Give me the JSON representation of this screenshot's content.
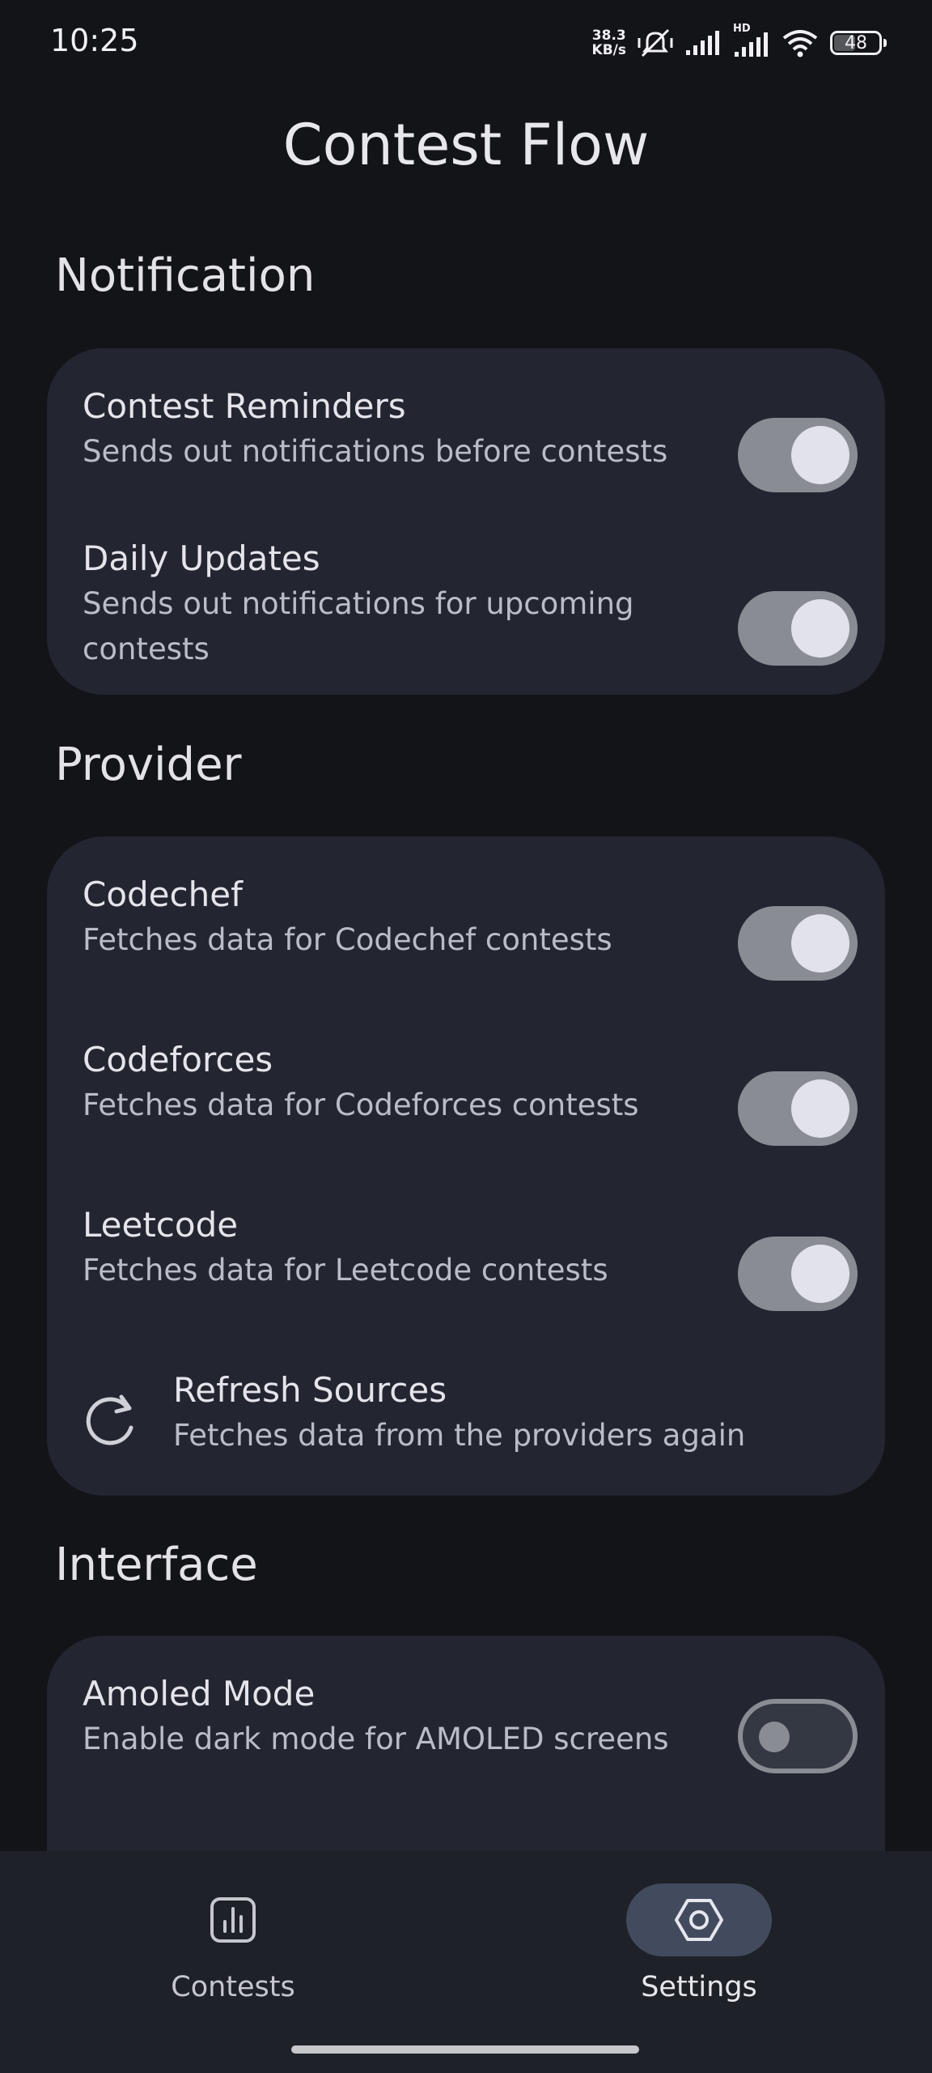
{
  "status_bar": {
    "time": "10:25",
    "net_speed_value": "38.3",
    "net_speed_unit": "KB/s",
    "hd_label": "HD",
    "battery": "48",
    "battery_level": 0.48
  },
  "app": {
    "title": "Contest Flow"
  },
  "sections": {
    "notification": {
      "title": "Notification",
      "items": [
        {
          "title": "Contest Reminders",
          "desc": "Sends out notifications before contests",
          "enabled": true
        },
        {
          "title": "Daily Updates",
          "desc": "Sends out notifications for upcoming contests",
          "enabled": true
        }
      ]
    },
    "provider": {
      "title": "Provider",
      "items": [
        {
          "title": "Codechef",
          "desc": "Fetches data for Codechef contests",
          "enabled": true
        },
        {
          "title": "Codeforces",
          "desc": "Fetches data for Codeforces contests",
          "enabled": true
        },
        {
          "title": "Leetcode",
          "desc": "Fetches data for Leetcode contests",
          "enabled": true
        }
      ],
      "refresh": {
        "title": "Refresh Sources",
        "desc": "Fetches data from the providers again",
        "icon": "refresh-icon"
      }
    },
    "interface": {
      "title": "Interface",
      "items": [
        {
          "title": "Amoled Mode",
          "desc": "Enable dark mode for AMOLED screens",
          "enabled": false
        }
      ]
    }
  },
  "bottom_nav": {
    "items": [
      {
        "label": "Contests",
        "icon": "bar-chart-icon",
        "active": false
      },
      {
        "label": "Settings",
        "icon": "settings-hexagon-icon",
        "active": true
      }
    ]
  },
  "colors": {
    "background": "#131418",
    "card": "#232631",
    "switch_on_track": "#8a8c94",
    "switch_thumb": "#e1e2ea",
    "nav_active_pill": "#424b5e"
  }
}
